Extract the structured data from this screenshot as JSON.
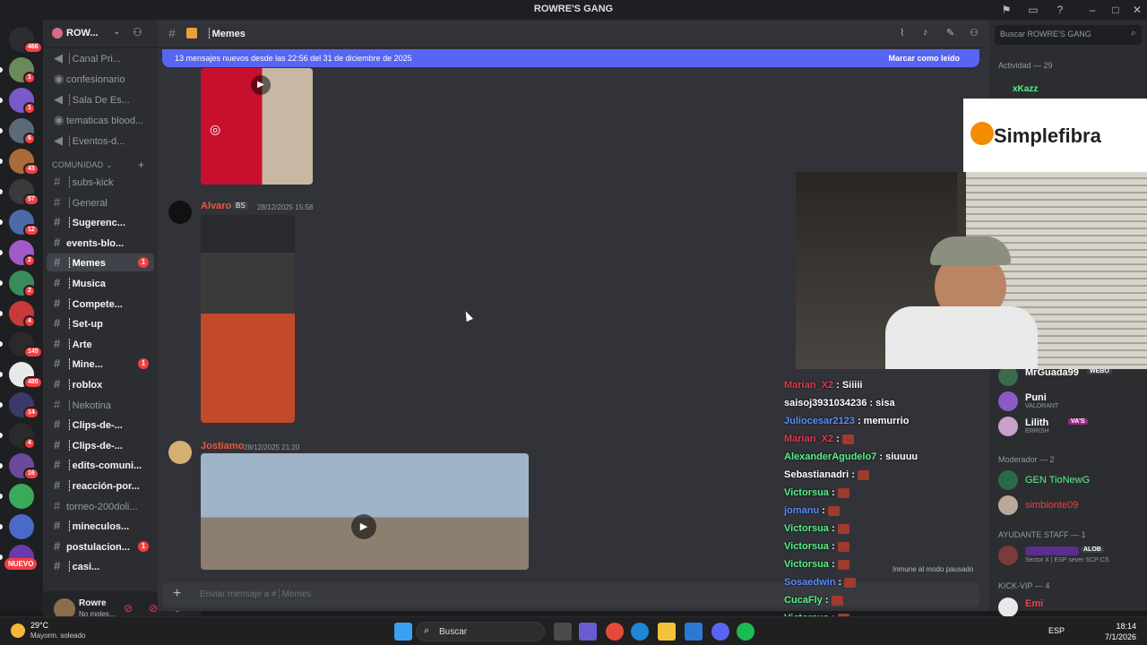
{
  "window": {
    "title": "ROWRE'S GANG"
  },
  "servers": {
    "badges": [
      "466",
      "1",
      "1",
      "6",
      "43",
      "57",
      "12",
      "2",
      "2",
      "4",
      "145",
      "480",
      "14",
      "4",
      "16"
    ],
    "new_label": "NUEVO"
  },
  "guild": {
    "name": "ROW..."
  },
  "channels": {
    "top": [
      {
        "label": "┊Canal Pri...",
        "type": "voice",
        "bright": false
      },
      {
        "label": "confesionario",
        "type": "forum",
        "bright": false
      },
      {
        "label": "┊Sala De Es...",
        "type": "voice",
        "bright": false
      },
      {
        "label": "tematicas blood...",
        "type": "forum",
        "bright": false
      },
      {
        "label": "┊Eventos-d...",
        "type": "voice",
        "bright": false
      }
    ],
    "category": "COMUNIDAD",
    "list": [
      {
        "label": "┊subs-kick",
        "bright": false,
        "badge": ""
      },
      {
        "label": "┊General",
        "bright": false,
        "badge": ""
      },
      {
        "label": "┊Sugerenc...",
        "bright": true,
        "badge": ""
      },
      {
        "label": "events-blo...",
        "bright": true,
        "badge": ""
      },
      {
        "label": "┊Memes",
        "bright": true,
        "badge": "1",
        "active": true
      },
      {
        "label": "┊Musica",
        "bright": true,
        "badge": ""
      },
      {
        "label": "┊Compete...",
        "bright": true,
        "badge": ""
      },
      {
        "label": "┊Set-up",
        "bright": true,
        "badge": ""
      },
      {
        "label": "┊Arte",
        "bright": true,
        "badge": ""
      },
      {
        "label": "┊Mine...",
        "bright": true,
        "badge": "1"
      },
      {
        "label": "┊roblox",
        "bright": true,
        "badge": ""
      },
      {
        "label": "┊Nekotina",
        "bright": false,
        "badge": ""
      },
      {
        "label": "┊Clips-de-...",
        "bright": true,
        "badge": ""
      },
      {
        "label": "┊Clips-de-...",
        "bright": true,
        "badge": ""
      },
      {
        "label": "┊edits-comuni...",
        "bright": true,
        "badge": ""
      },
      {
        "label": "┊reacción-por...",
        "bright": true,
        "badge": ""
      },
      {
        "label": "torneo-200doli...",
        "bright": false,
        "badge": ""
      },
      {
        "label": "┊mineculos...",
        "bright": true,
        "badge": ""
      },
      {
        "label": "postulacion...",
        "bright": true,
        "badge": "1"
      },
      {
        "label": "┊casi...",
        "bright": true,
        "badge": ""
      }
    ]
  },
  "user": {
    "name": "Rowre",
    "status": "No moles..."
  },
  "chat": {
    "channel": "┊Memes",
    "banner": "13 mensajes nuevos desde las 22:56 del 31 de diciembre de 2025",
    "mark_read": "Marcar como leído",
    "messages": [
      {
        "author": "Alvaro",
        "tag": "BS",
        "time": "28/12/2025 15:58",
        "color": "#e8573e"
      },
      {
        "author": "Jostiamo",
        "tag": "",
        "time": "28/12/2025 21:20",
        "color": "#e8573e"
      }
    ],
    "composer_placeholder": "Enviar mensaje a #┊Memes"
  },
  "search": {
    "placeholder": "Buscar ROWRE'S GANG"
  },
  "members": {
    "activity": "Actividad — 29",
    "top_member": "xKazz",
    "list": [
      {
        "name": "MrGuada99",
        "tag": "WEBO",
        "sub": "",
        "color": "#ffffff"
      },
      {
        "name": "Puni",
        "tag": "",
        "sub": "VALORANT",
        "color": "#ffffff"
      },
      {
        "name": "Lilith",
        "tag": "VA'S",
        "sub": "ERRISH",
        "color": "#ffffff"
      }
    ],
    "moderator_section": "Moderador — 2",
    "moderators": [
      {
        "name": "GEN TioNewG",
        "color": "#57f287"
      },
      {
        "name": "simbionte09",
        "color": "#f23f43"
      }
    ],
    "staff_section": "AYUDANTE STAFF — 1",
    "staff": {
      "tag": "ALOB",
      "sub": "Sector X | ESP sever SCP:CS"
    },
    "vip_section": "KICK-VIP — 4",
    "vip": {
      "name": "Emi",
      "color": "#f23f43"
    }
  },
  "sponsor": {
    "brand": "Simplefibra"
  },
  "overlay_chat": [
    {
      "user": "Marian_X2",
      "msg": "Siiiii",
      "color": "#e8394e"
    },
    {
      "user": "saisoj3931034236",
      "msg": "sisa",
      "color": "#ffffff"
    },
    {
      "user": "Juliocesar2123",
      "msg": "memurrio",
      "color": "#5b8cff"
    },
    {
      "user": "Marian_X2",
      "msg": "",
      "color": "#e8394e"
    },
    {
      "user": "AlexanderAgudelo7",
      "msg": "siuuuu",
      "color": "#57f287"
    },
    {
      "user": "Sebastianadri",
      "msg": "",
      "color": "#ffffff"
    },
    {
      "user": "Victorsua",
      "msg": "",
      "color": "#57f287"
    },
    {
      "user": "jomanu",
      "msg": "",
      "color": "#5b8cff"
    },
    {
      "user": "Victorsua",
      "msg": "",
      "color": "#57f287"
    },
    {
      "user": "Victorsua",
      "msg": "",
      "color": "#57f287"
    },
    {
      "user": "Victorsua",
      "msg": "",
      "color": "#57f287"
    },
    {
      "user": "Sosaedwin",
      "msg": "",
      "color": "#5b8cff"
    },
    {
      "user": "CucaFly",
      "msg": "",
      "color": "#57f287"
    },
    {
      "user": "Victorsua",
      "msg": "",
      "color": "#57f287"
    }
  ],
  "immune_text": "Inmune al modo pausado",
  "taskbar": {
    "weather_temp": "29°C",
    "weather_desc": "Mayorm. soleado",
    "search": "Buscar",
    "lang": "ESP",
    "time": "18:14",
    "date": "7/1/2026"
  }
}
